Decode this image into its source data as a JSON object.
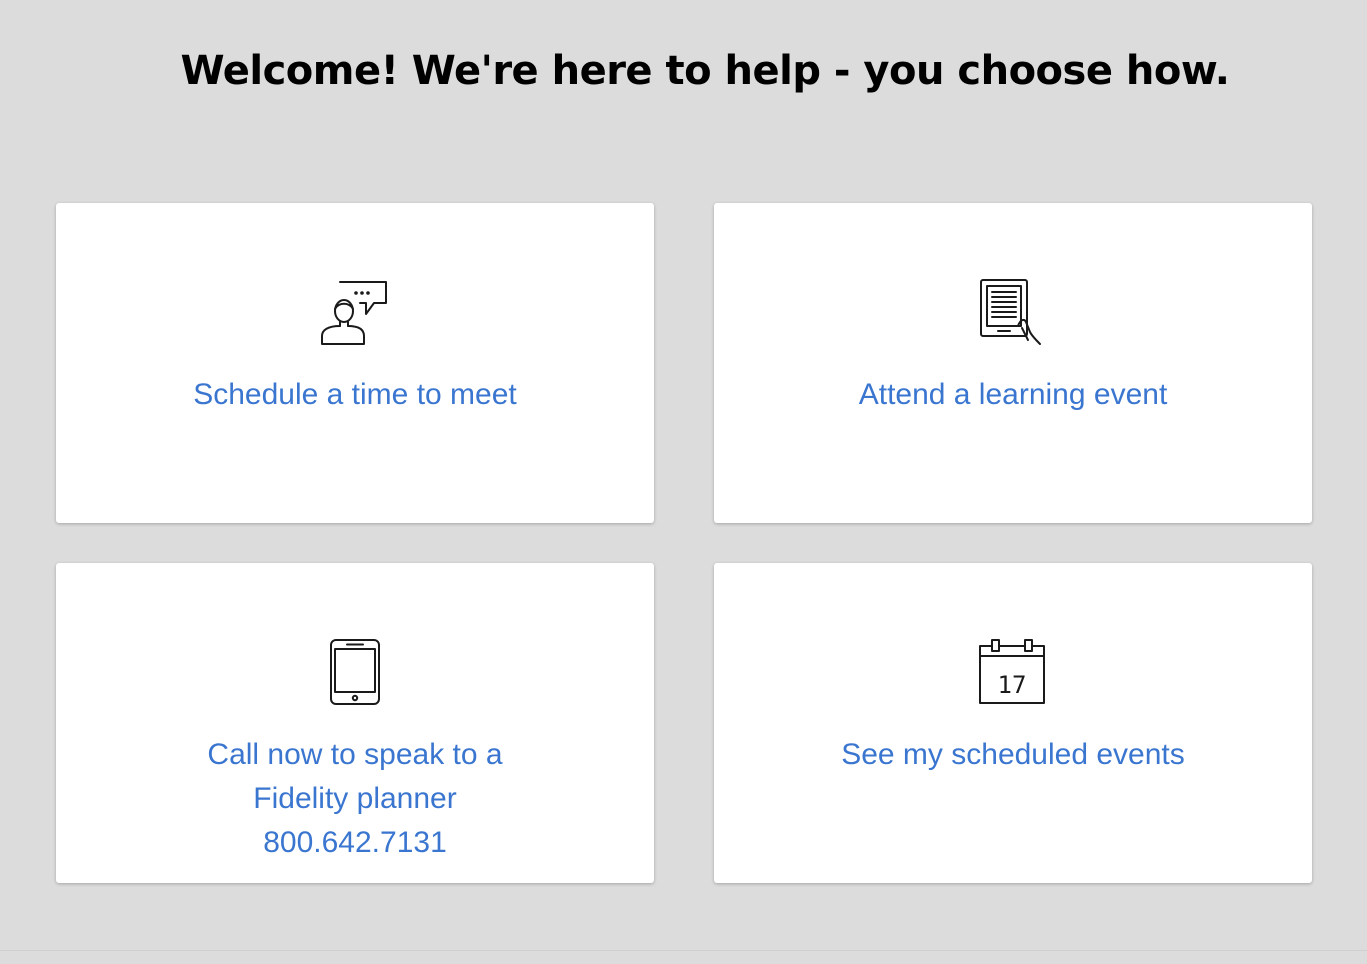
{
  "page": {
    "heading": "Welcome! We're here to help - you choose how."
  },
  "colors": {
    "background": "#dcdcdc",
    "card": "#ffffff",
    "link": "#3a76d0",
    "icon": "#1a1a1a"
  },
  "cards": [
    {
      "icon": "person-chat-icon",
      "label": "Schedule a time to meet"
    },
    {
      "icon": "tablet-reader-icon",
      "label": "Attend a learning event"
    },
    {
      "icon": "phone-icon",
      "label_lines": [
        "Call now to speak to a",
        "Fidelity planner",
        "800.642.7131"
      ]
    },
    {
      "icon": "calendar-icon",
      "calendar_day": "17",
      "label": "See my scheduled events"
    }
  ]
}
